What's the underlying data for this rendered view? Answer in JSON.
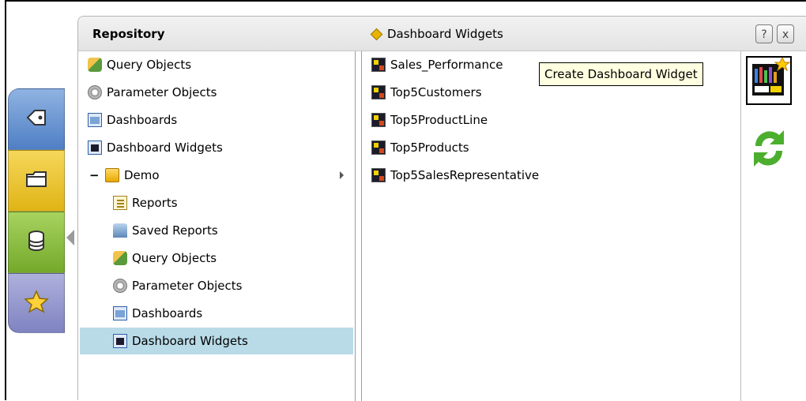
{
  "colors": {
    "selection": "#b9dbe8",
    "tooltip_bg": "#ffffe1"
  },
  "left_tabs": [
    {
      "icon": "tag-icon"
    },
    {
      "icon": "folder-icon"
    },
    {
      "icon": "database-icon"
    },
    {
      "icon": "star-icon"
    }
  ],
  "header": {
    "title": "Repository",
    "breadcrumb": "Dashboard Widgets",
    "help_label": "?",
    "close_label": "x"
  },
  "tree": {
    "items": [
      {
        "label": "Query Objects",
        "icon": "query-object-icon"
      },
      {
        "label": "Parameter Objects",
        "icon": "gear-icon"
      },
      {
        "label": "Dashboards",
        "icon": "dashboard-icon"
      },
      {
        "label": "Dashboard Widgets",
        "icon": "dashboard-widget-icon"
      },
      {
        "label": "Demo",
        "icon": "folder-icon",
        "expander": "−"
      },
      {
        "label": "Reports",
        "icon": "report-icon"
      },
      {
        "label": "Saved Reports",
        "icon": "saved-report-icon"
      },
      {
        "label": "Query Objects",
        "icon": "query-object-icon"
      },
      {
        "label": "Parameter Objects",
        "icon": "gear-icon"
      },
      {
        "label": "Dashboards",
        "icon": "dashboard-icon"
      },
      {
        "label": "Dashboard Widgets",
        "icon": "dashboard-widget-icon"
      }
    ]
  },
  "list": {
    "items": [
      {
        "label": "Sales_Performance"
      },
      {
        "label": "Top5Customers"
      },
      {
        "label": "Top5ProductLine"
      },
      {
        "label": "Top5Products"
      },
      {
        "label": "Top5SalesRepresentative"
      }
    ]
  },
  "tooltip": {
    "text": "Create Dashboard Widget"
  },
  "actions": {
    "create_widget": "create-dashboard-widget-icon",
    "refresh": "refresh-icon"
  }
}
